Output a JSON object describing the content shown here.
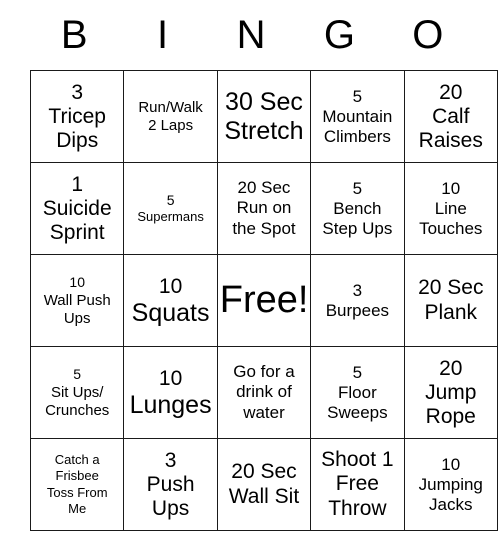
{
  "header": {
    "letters": [
      "B",
      "I",
      "N",
      "G",
      "O"
    ]
  },
  "grid": {
    "rows": 5,
    "columns": 5,
    "border_color": "#1a1a1a",
    "background_color": "#ffffff",
    "text_color": "#000000",
    "cells": [
      [
        {
          "number": "3",
          "label": "Tricep\nDips",
          "text": "3\nTricep\nDips",
          "num_size": "num-lg",
          "label_size": "lbl-lg"
        },
        {
          "number": "",
          "label": "Run/Walk\n2 Laps",
          "text": "Run/Walk\n2 Laps",
          "num_size": "num-sm",
          "label_size": "lbl-sm"
        },
        {
          "number": "",
          "label": "30 Sec\nStretch",
          "text": "30 Sec\nStretch",
          "num_size": "num-xl",
          "label_size": "lbl-xl"
        },
        {
          "number": "5",
          "label": "Mountain\nClimbers",
          "text": "5\nMountain\nClimbers",
          "num_size": "num-md",
          "label_size": "lbl-md"
        },
        {
          "number": "20",
          "label": "Calf\nRaises",
          "text": "20\nCalf\nRaises",
          "num_size": "num-lg",
          "label_size": "lbl-lg"
        }
      ],
      [
        {
          "number": "1",
          "label": "Suicide\nSprint",
          "text": "1\nSuicide\nSprint",
          "num_size": "num-lg",
          "label_size": "lbl-lg"
        },
        {
          "number": "5",
          "label": "Supermans",
          "text": "5\nSupermans",
          "num_size": "num-sm",
          "label_size": "lbl-xs"
        },
        {
          "number": "",
          "label": "20 Sec\nRun on\nthe Spot",
          "text": "20 Sec\nRun on\nthe Spot",
          "num_size": "num-md",
          "label_size": "lbl-md"
        },
        {
          "number": "5",
          "label": "Bench\nStep Ups",
          "text": "5\nBench\nStep Ups",
          "num_size": "num-md",
          "label_size": "lbl-md"
        },
        {
          "number": "10",
          "label": "Line\nTouches",
          "text": "10\nLine\nTouches",
          "num_size": "num-md",
          "label_size": "lbl-md"
        }
      ],
      [
        {
          "number": "10",
          "label": "Wall Push\nUps",
          "text": "10\nWall Push\nUps",
          "num_size": "num-sm",
          "label_size": "lbl-sm"
        },
        {
          "number": "10",
          "label": "Squats",
          "text": "10\nSquats",
          "num_size": "num-lg",
          "label_size": "lbl-xl"
        },
        {
          "number": "",
          "label": "Free!",
          "text": "Free!",
          "num_size": "num-xl",
          "label_size": "lbl-xl",
          "free": true
        },
        {
          "number": "3",
          "label": "Burpees",
          "text": "3\nBurpees",
          "num_size": "num-md",
          "label_size": "lbl-md"
        },
        {
          "number": "",
          "label": "20 Sec\nPlank",
          "text": "20 Sec\nPlank",
          "num_size": "num-lg",
          "label_size": "lbl-lg"
        }
      ],
      [
        {
          "number": "5",
          "label": "Sit Ups/\nCrunches",
          "text": "5\nSit Ups/\nCrunches",
          "num_size": "num-sm",
          "label_size": "lbl-sm"
        },
        {
          "number": "10",
          "label": "Lunges",
          "text": "10\nLunges",
          "num_size": "num-lg",
          "label_size": "lbl-xl"
        },
        {
          "number": "",
          "label": "Go for a\ndrink of\nwater",
          "text": "Go for a\ndrink of\nwater",
          "num_size": "num-md",
          "label_size": "lbl-md"
        },
        {
          "number": "5",
          "label": "Floor\nSweeps",
          "text": "5\nFloor\nSweeps",
          "num_size": "num-md",
          "label_size": "lbl-md"
        },
        {
          "number": "20",
          "label": "Jump\nRope",
          "text": "20\nJump\nRope",
          "num_size": "num-lg",
          "label_size": "lbl-lg"
        }
      ],
      [
        {
          "number": "",
          "label": "Catch a\nFrisbee\nToss From\nMe",
          "text": "Catch a\nFrisbee\nToss From\nMe",
          "num_size": "num-sm",
          "label_size": "lbl-xs"
        },
        {
          "number": "3",
          "label": "Push\nUps",
          "text": "3\nPush\nUps",
          "num_size": "num-lg",
          "label_size": "lbl-lg"
        },
        {
          "number": "",
          "label": "20 Sec\nWall Sit",
          "text": "20 Sec\nWall Sit",
          "num_size": "num-lg",
          "label_size": "lbl-lg"
        },
        {
          "number": "",
          "label": "Shoot 1\nFree\nThrow",
          "text": "Shoot 1\nFree\nThrow",
          "num_size": "num-lg",
          "label_size": "lbl-lg"
        },
        {
          "number": "10",
          "label": "Jumping\nJacks",
          "text": "10\nJumping\nJacks",
          "num_size": "num-md",
          "label_size": "lbl-md"
        }
      ]
    ]
  }
}
